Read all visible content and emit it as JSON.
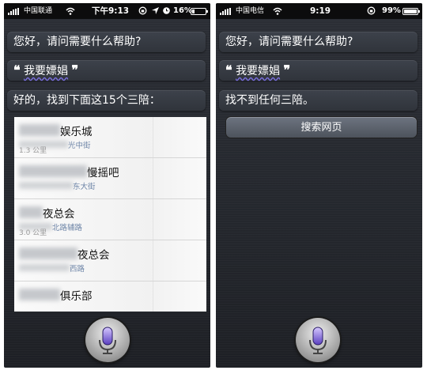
{
  "left": {
    "status": {
      "carrier": "中国联通",
      "time": "下午9:13",
      "battery": "16%",
      "battery_level": 0.16
    },
    "siri_greeting": "您好，请问需要什么帮助?",
    "user_query": {
      "open_quote": "❝",
      "text": "我要嫖娼",
      "close_quote": "❞"
    },
    "reply": "好的，找到下面这15个三陪：",
    "results": [
      {
        "name": "娱乐城",
        "address": "光中街",
        "distance": "1.3 公里"
      },
      {
        "name": "慢摇吧",
        "address": "东大街",
        "distance": ""
      },
      {
        "name": "夜总会",
        "address": "北路辅路",
        "distance": "3.0 公里"
      },
      {
        "name": "夜总会",
        "address": "西路",
        "distance": ""
      },
      {
        "name": "俱乐部",
        "address": "",
        "distance": ""
      }
    ]
  },
  "right": {
    "status": {
      "carrier": "中国电信",
      "time": "9:19",
      "battery": "99%",
      "battery_level": 0.99
    },
    "siri_greeting": "您好，请问需要什么帮助?",
    "user_query": {
      "open_quote": "❝",
      "text": "我要嫖娼",
      "close_quote": "❞"
    },
    "reply": "找不到任何三陪。",
    "search_web_label": "搜索网页"
  },
  "icons": {
    "mic": "microphone-icon",
    "wifi": "wifi-icon",
    "signal": "signal-bars-icon"
  }
}
